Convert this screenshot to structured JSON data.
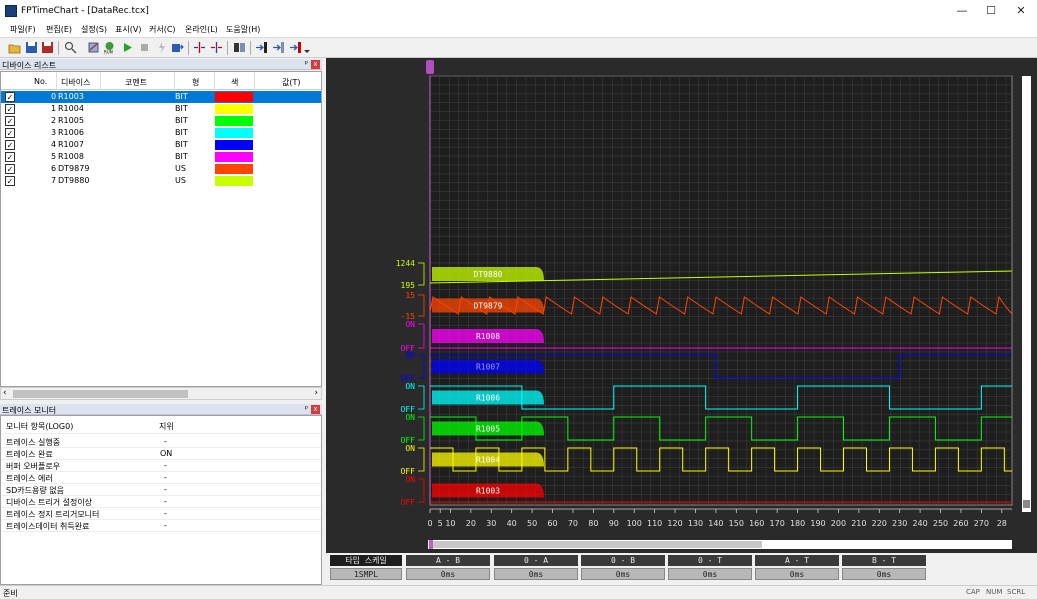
{
  "window": {
    "title": "FPTimeChart - [DataRec.tcx]",
    "minimize": "—",
    "maximize": "☐",
    "close": "✕"
  },
  "menu": [
    "파일(F)",
    "편집(E)",
    "설정(S)",
    "표시(V)",
    "커서(C)",
    "온라인(L)",
    "도움말(H)"
  ],
  "toolbar": {
    "icons": [
      "open-icon",
      "save-icon",
      "save-as-icon",
      "search-icon",
      "settings-icon",
      "run-icon",
      "play-icon",
      "stop-icon",
      "trigger-icon",
      "export-icon",
      "cursor-a-icon",
      "cursor-b-icon",
      "compare-icon",
      "jump-a-icon",
      "jump-b-icon",
      "jump-t-icon",
      "dropdown-icon"
    ]
  },
  "device_panel": {
    "title": "디바이스 리스트",
    "pin": "ᵖ",
    "close": "x",
    "headers": {
      "no": "No.",
      "device": "디바이스",
      "comment": "코멘트",
      "type": "형",
      "color": "색",
      "value": "값(T)"
    },
    "rows": [
      {
        "no": "0",
        "device": "R1003",
        "type": "BIT",
        "color": "#ff0000",
        "checked": "✓"
      },
      {
        "no": "1",
        "device": "R1004",
        "type": "BIT",
        "color": "#ffff00",
        "checked": "✓"
      },
      {
        "no": "2",
        "device": "R1005",
        "type": "BIT",
        "color": "#00ff00",
        "checked": "✓"
      },
      {
        "no": "3",
        "device": "R1006",
        "type": "BIT",
        "color": "#00ffff",
        "checked": "✓"
      },
      {
        "no": "4",
        "device": "R1007",
        "type": "BIT",
        "color": "#0000ff",
        "checked": "✓"
      },
      {
        "no": "5",
        "device": "R1008",
        "type": "BIT",
        "color": "#ff00ff",
        "checked": "✓"
      },
      {
        "no": "6",
        "device": "DT9879",
        "type": "US",
        "color": "#ff4500",
        "checked": "✓"
      },
      {
        "no": "7",
        "device": "DT9880",
        "type": "US",
        "color": "#c8ff00",
        "checked": "✓"
      }
    ],
    "scroll_left": "‹",
    "scroll_right": "›"
  },
  "trace_panel": {
    "title": "트레이스 모니터",
    "pin": "ᵖ",
    "close": "x",
    "headers": {
      "item": "모니터 항목(LOG0)",
      "state": "지위"
    },
    "rows": [
      {
        "item": "트레이스 실행중",
        "state": "-"
      },
      {
        "item": "트레이스 완료",
        "state": "ON"
      },
      {
        "item": "버퍼 오버플로우",
        "state": "-"
      },
      {
        "item": "트레이스 에러",
        "state": "-"
      },
      {
        "item": "SD카드용량 없음",
        "state": "-"
      },
      {
        "item": "디바이스 트리거 설정이상",
        "state": "-"
      },
      {
        "item": "트레이스 정지 트리거모니터",
        "state": "-"
      },
      {
        "item": "트레이스데이터 취득완료",
        "state": "-"
      }
    ]
  },
  "chart_data": {
    "type": "line",
    "x_ticks": [
      "0",
      "5",
      "10",
      "20",
      "30",
      "40",
      "50",
      "60",
      "70",
      "80",
      "90",
      "100",
      "110",
      "120",
      "130",
      "140",
      "150",
      "160",
      "170",
      "180",
      "190",
      "200",
      "210",
      "220",
      "230",
      "240",
      "250",
      "260",
      "270",
      "28"
    ],
    "signals": [
      {
        "name": "DT9880",
        "color": "#c8ff00",
        "hi_label": "1244",
        "lo_label": "195"
      },
      {
        "name": "DT9879",
        "color": "#ff4500",
        "hi_label": "15",
        "lo_label": "-15"
      },
      {
        "name": "R1008",
        "color": "#ff00ff",
        "hi_label": "ON",
        "lo_label": "OFF",
        "period": 0,
        "state": "OFF"
      },
      {
        "name": "R1007",
        "color": "#0000ff",
        "hi_label": "ON",
        "lo_label": "OFF",
        "edges": [
          0,
          140,
          230,
          285
        ]
      },
      {
        "name": "R1006",
        "color": "#00ffff",
        "hi_label": "ON",
        "lo_label": "OFF",
        "period": 90
      },
      {
        "name": "R1005",
        "color": "#00ff00",
        "hi_label": "ON",
        "lo_label": "OFF",
        "period": 45
      },
      {
        "name": "R1004",
        "color": "#ffff00",
        "hi_label": "ON",
        "lo_label": "OFF",
        "period": 22.5
      },
      {
        "name": "R1003",
        "color": "#ff0000",
        "hi_label": "ON",
        "lo_label": "OFF",
        "state": "OFF"
      }
    ]
  },
  "cursor_bar": {
    "time_scale_label": "타임 스케일",
    "time_scale_value": "1SMPL",
    "columns": [
      {
        "label": "A - B",
        "value": "0ms"
      },
      {
        "label": "0 - A",
        "value": "0ms"
      },
      {
        "label": "0 - B",
        "value": "0ms"
      },
      {
        "label": "0 - T",
        "value": "0ms"
      },
      {
        "label": "A - T",
        "value": "0ms"
      },
      {
        "label": "B - T",
        "value": "0ms"
      }
    ]
  },
  "status": {
    "text": "준비",
    "cap": "CAP",
    "num": "NUM",
    "scrl": "SCRL"
  }
}
